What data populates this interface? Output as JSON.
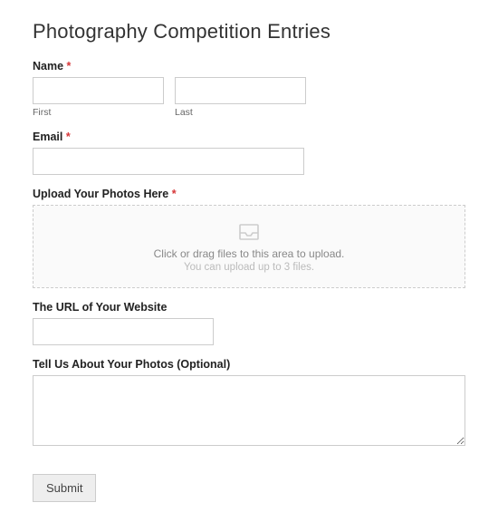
{
  "title": "Photography Competition Entries",
  "required_mark": "*",
  "name": {
    "label": "Name",
    "required": true,
    "first_sub": "First",
    "last_sub": "Last",
    "first_value": "",
    "last_value": ""
  },
  "email": {
    "label": "Email",
    "required": true,
    "value": ""
  },
  "upload": {
    "label": "Upload Your Photos Here",
    "required": true,
    "primary": "Click or drag files to this area to upload.",
    "secondary": "You can upload up to 3 files."
  },
  "url": {
    "label": "The URL of Your Website",
    "value": ""
  },
  "about": {
    "label": "Tell Us About Your Photos (Optional)",
    "value": ""
  },
  "submit_label": "Submit"
}
